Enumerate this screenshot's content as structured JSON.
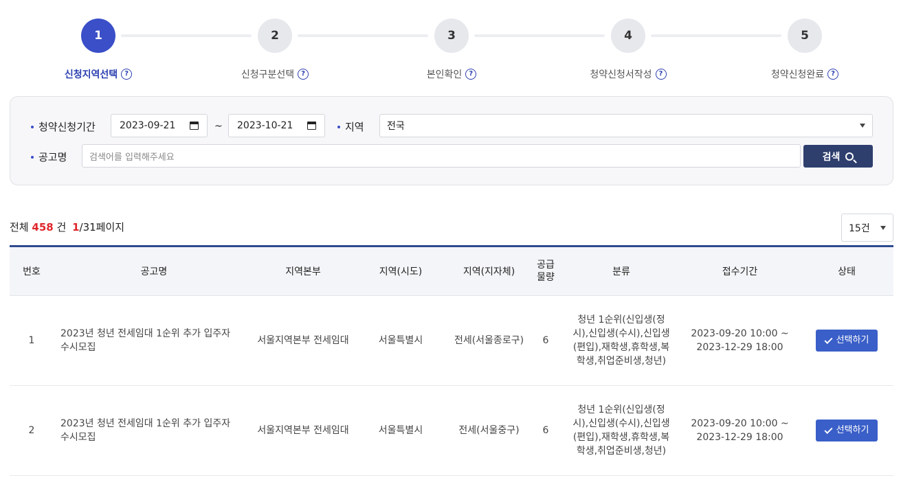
{
  "stepper": {
    "steps": [
      {
        "number": "1",
        "label": "신청지역선택"
      },
      {
        "number": "2",
        "label": "신청구분선택"
      },
      {
        "number": "3",
        "label": "본인확인"
      },
      {
        "number": "4",
        "label": "청약신청서작성"
      },
      {
        "number": "5",
        "label": "청약신청완료"
      }
    ],
    "help_glyph": "?",
    "active_step": 1,
    "colors": {
      "active": "#3a4fc8",
      "inactive": "#e6e8ec"
    }
  },
  "search": {
    "period_label": "청약신청기간",
    "start_date": "2023-09-21",
    "separator": "~",
    "end_date": "2023-10-21",
    "region_label": "지역",
    "region_value": "전국",
    "title_label": "공고명",
    "title_placeholder": "검색어를 입력해주세요",
    "search_button": "검색"
  },
  "summary": {
    "prefix": "전체",
    "total": "458",
    "unit": "건",
    "current_page": "1",
    "page_suffix": "/31페이지",
    "page_size": "15건"
  },
  "table": {
    "headers": [
      "번호",
      "공고명",
      "지역본부",
      "지역(시도)",
      "지역(지자체)",
      "공급\n물량",
      "분류",
      "접수기간",
      "상태"
    ],
    "supply_header_lines": [
      "공급",
      "물량"
    ],
    "rows": [
      {
        "no": "1",
        "title": "2023년 청년 전세임대 1순위 추가 입주자 수시모집",
        "hq": "서울지역본부 전세임대",
        "province": "서울특별시",
        "district": "전세(서울종로구)",
        "qty": "6",
        "category": "청년 1순위(신입생(정시),신입생(수시),신입생(편입),재학생,휴학생,복학생,취업준비생,청년)",
        "period_start": "2023-09-20 10:00 ~",
        "period_end": "2023-12-29 18:00",
        "action": "선택하기"
      },
      {
        "no": "2",
        "title": "2023년 청년 전세임대 1순위 추가 입주자 수시모집",
        "hq": "서울지역본부 전세임대",
        "province": "서울특별시",
        "district": "전세(서울중구)",
        "qty": "6",
        "category": "청년 1순위(신입생(정시),신입생(수시),신입생(편입),재학생,휴학생,복학생,취업준비생,청년)",
        "period_start": "2023-09-20 10:00 ~",
        "period_end": "2023-12-29 18:00",
        "action": "선택하기"
      }
    ]
  }
}
